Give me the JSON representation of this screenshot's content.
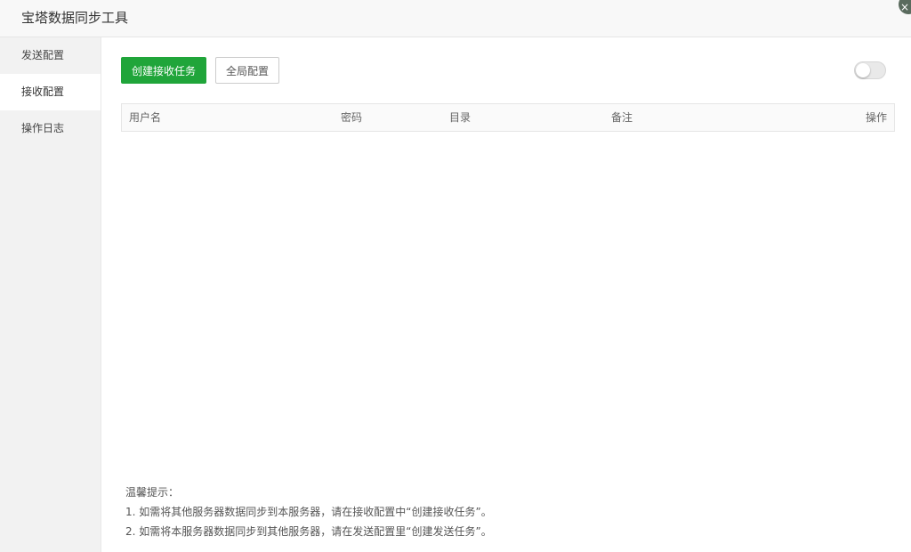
{
  "window": {
    "title": "宝塔数据同步工具",
    "close_icon": "×"
  },
  "sidebar": {
    "items": [
      {
        "label": "发送配置"
      },
      {
        "label": "接收配置"
      },
      {
        "label": "操作日志"
      }
    ],
    "active_index": 1
  },
  "toolbar": {
    "create_label": "创建接收任务",
    "global_label": "全局配置",
    "toggle_on": false
  },
  "table": {
    "columns": [
      "用户名",
      "密码",
      "目录",
      "备注",
      "操作"
    ],
    "rows": []
  },
  "tips": {
    "title": "温馨提示：",
    "lines": [
      "1. 如需将其他服务器数据同步到本服务器，请在接收配置中“创建接收任务”。",
      "2. 如需将本服务器数据同步到其他服务器，请在发送配置里“创建发送任务”。"
    ]
  },
  "colors": {
    "accent": "#20a53a"
  }
}
